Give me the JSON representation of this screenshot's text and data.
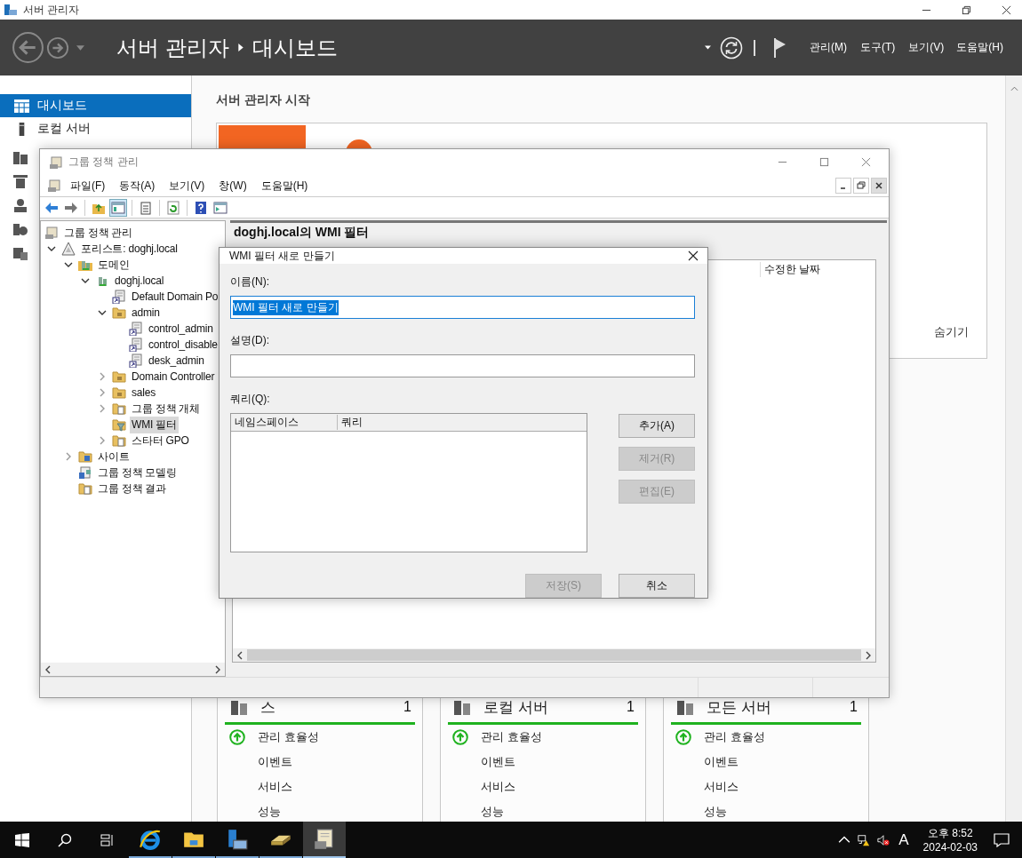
{
  "app_window": {
    "title": "서버 관리자"
  },
  "header": {
    "breadcrumb": [
      "서버 관리자",
      "대시보드"
    ],
    "menus": [
      "관리(M)",
      "도구(T)",
      "보기(V)",
      "도움말(H)"
    ]
  },
  "nav": [
    {
      "label": "대시보드",
      "selected": true
    },
    {
      "label": "로컬 서버",
      "selected": false
    }
  ],
  "welcome": {
    "heading": "서버 관리자 시작",
    "hide_link": "숨기기"
  },
  "tiles": [
    {
      "title": "스",
      "count": "1",
      "rows": [
        {
          "label": "관리 효율성",
          "healthy": true
        },
        {
          "label": "이벤트",
          "healthy": false
        },
        {
          "label": "서비스",
          "healthy": false
        },
        {
          "label": "성능",
          "healthy": false
        }
      ]
    },
    {
      "title": "로컬 서버",
      "count": "1",
      "rows": [
        {
          "label": "관리 효율성",
          "healthy": true
        },
        {
          "label": "이벤트",
          "healthy": false
        },
        {
          "label": "서비스",
          "healthy": false
        },
        {
          "label": "성능",
          "healthy": false
        }
      ]
    },
    {
      "title": "모든 서버",
      "count": "1",
      "rows": [
        {
          "label": "관리 효율성",
          "healthy": true
        },
        {
          "label": "이벤트",
          "healthy": false
        },
        {
          "label": "서비스",
          "healthy": false
        },
        {
          "label": "성능",
          "healthy": false
        }
      ]
    }
  ],
  "gpm": {
    "title": "그룹 정책 관리",
    "menus": [
      "파일(F)",
      "동작(A)",
      "보기(V)",
      "창(W)",
      "도움말(H)"
    ],
    "tree": [
      {
        "label": "그룹 정책 관리",
        "kind": "root",
        "children": [
          {
            "label": "포리스트: doghj.local",
            "kind": "forest",
            "expanded": true,
            "children": [
              {
                "label": "도메인",
                "kind": "domains",
                "expanded": true,
                "children": [
                  {
                    "label": "doghj.local",
                    "kind": "domain",
                    "expanded": true,
                    "children": [
                      {
                        "label": "Default Domain Po",
                        "kind": "gpo"
                      },
                      {
                        "label": "admin",
                        "kind": "ou",
                        "expanded": true,
                        "children": [
                          {
                            "label": "control_admin",
                            "kind": "gpo"
                          },
                          {
                            "label": "control_disable",
                            "kind": "gpo"
                          },
                          {
                            "label": "desk_admin",
                            "kind": "gpo"
                          }
                        ]
                      },
                      {
                        "label": "Domain Controller",
                        "kind": "ou",
                        "expanded": false
                      },
                      {
                        "label": "sales",
                        "kind": "ou",
                        "expanded": false
                      },
                      {
                        "label": "그룹 정책 개체",
                        "kind": "gpofolder",
                        "expanded": false
                      },
                      {
                        "label": "WMI 필터",
                        "kind": "wmifolder",
                        "selected": true
                      },
                      {
                        "label": "스타터 GPO",
                        "kind": "gpofolder",
                        "expanded": false
                      }
                    ]
                  }
                ]
              },
              {
                "label": "사이트",
                "kind": "sites",
                "expanded": false
              },
              {
                "label": "그룹 정책 모델링",
                "kind": "modeling"
              },
              {
                "label": "그룹 정책 결과",
                "kind": "results"
              }
            ]
          }
        ]
      }
    ],
    "pane_title": "doghj.local의 WMI 필터",
    "columns": [
      "수정한 날짜"
    ]
  },
  "dialog": {
    "title": "WMI 필터 새로 만들기",
    "name_label": "이름(N):",
    "name_value": "WMI 필터 새로 만들기",
    "name_selected": true,
    "desc_label": "설명(D):",
    "query_label": "쿼리(Q):",
    "query_columns": [
      "네임스페이스",
      "쿼리"
    ],
    "side_buttons": [
      {
        "label": "추가(A)",
        "disabled": false
      },
      {
        "label": "제거(R)",
        "disabled": true
      },
      {
        "label": "편집(E)",
        "disabled": true
      }
    ],
    "footer_buttons": [
      {
        "label": "저장(S)",
        "disabled": true
      },
      {
        "label": "취소",
        "disabled": false
      }
    ]
  },
  "taskbar": {
    "apps": [
      {
        "kind": "browser",
        "active": false
      },
      {
        "kind": "explorer",
        "active": false
      },
      {
        "kind": "server",
        "active": false
      },
      {
        "kind": "tray",
        "active": false
      },
      {
        "kind": "scroll",
        "active": true
      }
    ],
    "ime": "A",
    "time": "오후 8:52",
    "date": "2024-02-03"
  }
}
